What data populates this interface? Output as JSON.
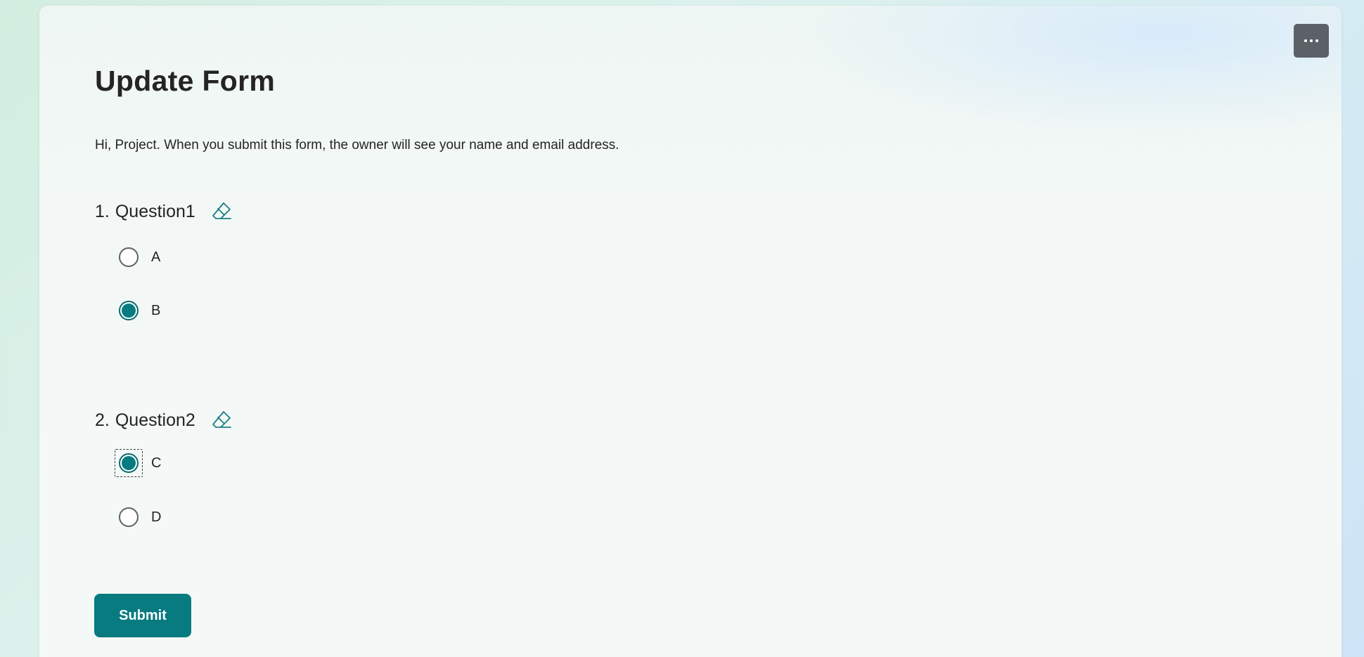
{
  "form": {
    "title": "Update Form",
    "description": "Hi, Project. When you submit this form, the owner will see your name and email address."
  },
  "questions": [
    {
      "number": "1.",
      "title": "Question1",
      "options": [
        {
          "label": "A",
          "selected": false
        },
        {
          "label": "B",
          "selected": true
        }
      ]
    },
    {
      "number": "2.",
      "title": "Question2",
      "options": [
        {
          "label": "C",
          "selected": true
        },
        {
          "label": "D",
          "selected": false
        }
      ]
    }
  ],
  "actions": {
    "submit_label": "Submit"
  },
  "icons": {
    "more": "more-options-icon",
    "clear": "eraser-icon"
  },
  "colors": {
    "accent": "#077b80",
    "more_button_bg": "#5b6166",
    "text": "#242424"
  }
}
